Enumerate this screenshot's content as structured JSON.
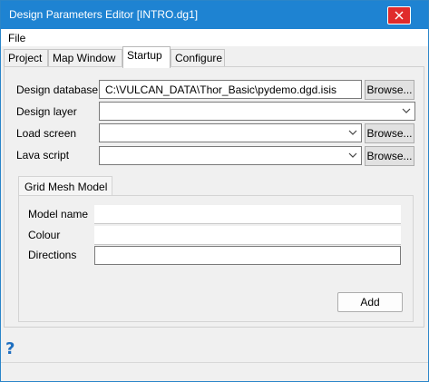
{
  "window": {
    "title": "Design Parameters Editor [INTRO.dg1]"
  },
  "menu": {
    "file": "File"
  },
  "tabs": [
    {
      "label": "Project",
      "active": false
    },
    {
      "label": "Map Window",
      "active": false
    },
    {
      "label": "Startup",
      "active": true
    },
    {
      "label": "Configure",
      "active": false
    }
  ],
  "startup": {
    "design_database": {
      "label": "Design database",
      "value": "C:\\VULCAN_DATA\\Thor_Basic\\pydemo.dgd.isis",
      "browse": "Browse..."
    },
    "design_layer": {
      "label": "Design layer",
      "value": ""
    },
    "load_screen": {
      "label": "Load screen",
      "value": "",
      "browse": "Browse..."
    },
    "lava_script": {
      "label": "Lava script",
      "value": "",
      "browse": "Browse..."
    }
  },
  "grid_mesh": {
    "title": "Grid Mesh Model",
    "model_name": {
      "label": "Model name",
      "value": ""
    },
    "colour": {
      "label": "Colour",
      "value": ""
    },
    "directions": {
      "label": "Directions",
      "value": ""
    },
    "add": "Add"
  },
  "help": {
    "symbol": "?"
  },
  "colors": {
    "title_bar": "#1e83d2",
    "close_button": "#e02b2b",
    "help_icon": "#1e6fc0"
  }
}
